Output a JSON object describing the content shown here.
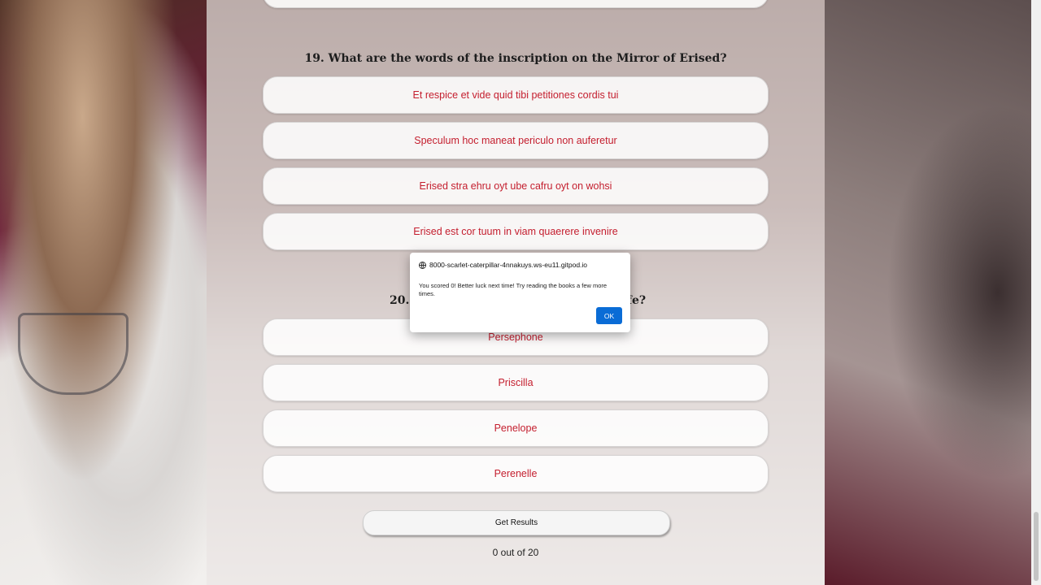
{
  "questions": [
    {
      "title": "19. What are the words of the inscription on the Mirror of Erised?",
      "answers": [
        "Et respice et vide quid tibi petitiones cordis tui",
        "Speculum hoc maneat periculo non auferetur",
        "Erised stra ehru oyt ube cafru oyt on wohsi",
        "Erised est cor tuum in viam quaerere invenire"
      ]
    },
    {
      "title_visible_start": "20.",
      "title_visible_end": "fe?",
      "answers": [
        "Persephone",
        "Priscilla",
        "Penelope",
        "Perenelle"
      ]
    }
  ],
  "results_button_label": "Get Results",
  "score_text": "0 out of 20",
  "dialog": {
    "origin": "8000-scarlet-caterpillar-4nnakuys.ws-eu11.gitpod.io",
    "message": "You scored 0! Better luck next time! Try reading the books a few more times.",
    "ok_label": "OK"
  },
  "colors": {
    "answer_text": "#c41e2e",
    "ok_button": "#0a6cd6"
  }
}
